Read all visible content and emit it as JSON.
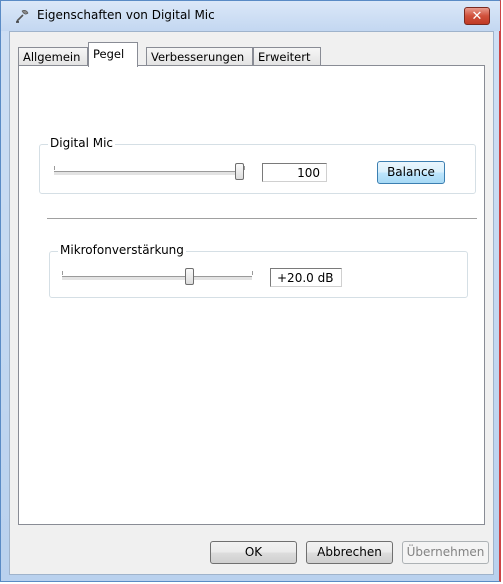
{
  "window": {
    "title": "Eigenschaften von Digital Mic",
    "close_glyph": "✕"
  },
  "tabs": [
    {
      "label": "Allgemein",
      "active": false
    },
    {
      "label": "Pegel",
      "active": true
    },
    {
      "label": "Verbesserungen",
      "active": false
    },
    {
      "label": "Erweitert",
      "active": false
    }
  ],
  "level_group": {
    "label": "Digital Mic",
    "slider_level_percent": 100,
    "value": "100",
    "balance_label": "Balance"
  },
  "boost_group": {
    "label": "Mikrofonverstärkung",
    "slider_level_fraction": 0.67,
    "value": "+20.0 dB"
  },
  "footer": {
    "ok_label": "OK",
    "cancel_label": "Abbrechen",
    "apply_label": "Übernehmen",
    "apply_enabled": false
  },
  "icons": {
    "app": "microphone-icon",
    "close": "close-icon"
  }
}
